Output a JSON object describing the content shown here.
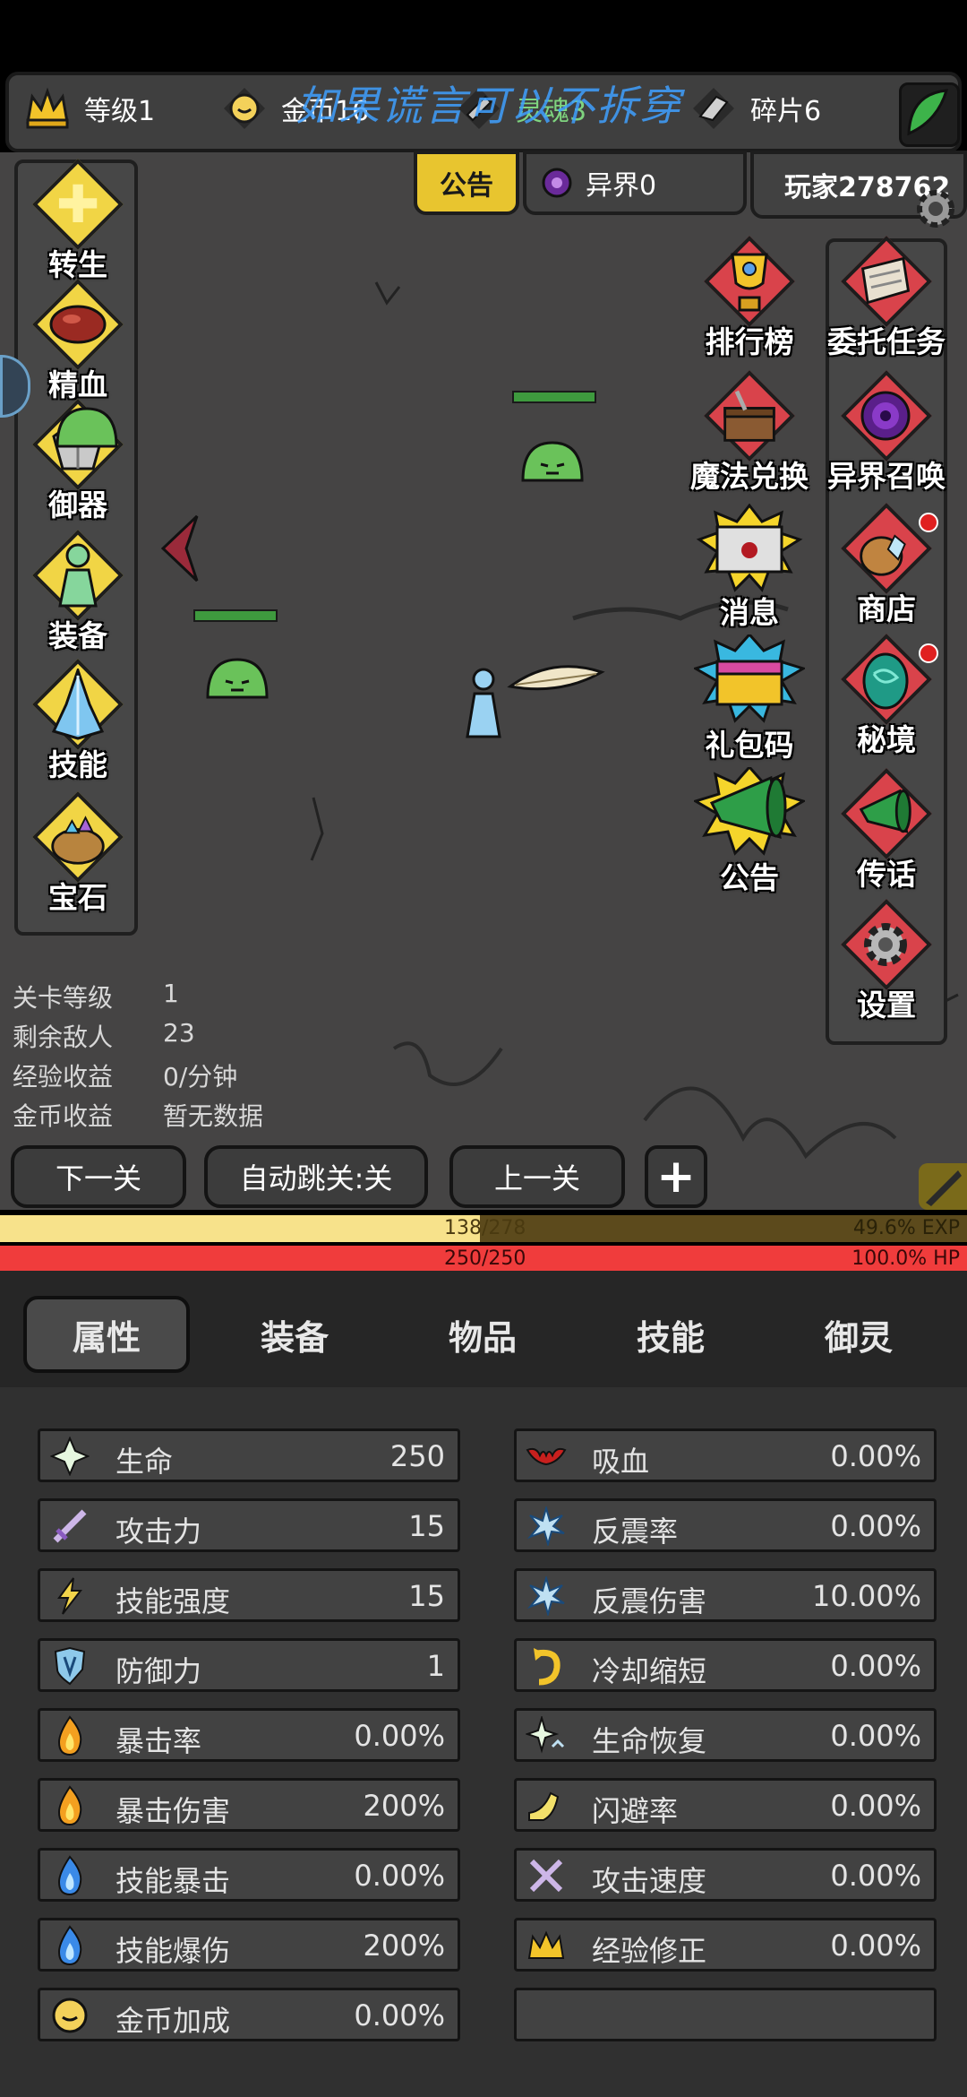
{
  "top_bar": {
    "level": "等级1",
    "gold": "金币16",
    "soul": "灵魂3",
    "fragments": "碎片6",
    "watermark": "如果谎言可以不拆穿"
  },
  "header_tabs": {
    "announcement": "公告",
    "otherworld": "异界0",
    "player": "玩家278762"
  },
  "left_menu": [
    "转生",
    "精血",
    "御器",
    "装备",
    "技能",
    "宝石"
  ],
  "right_menu_col1": [
    "排行榜",
    "魔法兑换",
    "消息",
    "礼包码",
    "公告"
  ],
  "right_menu_col2": [
    "委托任务",
    "异界召唤",
    "商店",
    "秘境",
    "传话",
    "设置"
  ],
  "level_stats": [
    {
      "label": "关卡等级",
      "value": "1"
    },
    {
      "label": "剩余敌人",
      "value": "23"
    },
    {
      "label": "经验收益",
      "value": "0/分钟"
    },
    {
      "label": "金币收益",
      "value": "暂无数据"
    }
  ],
  "nav_buttons": {
    "next": "下一关",
    "auto": "自动跳关:关",
    "prev": "上一关",
    "plus": "+"
  },
  "exp_bar": {
    "text": "138/278",
    "percent_text": "49.6% EXP",
    "fraction": 0.496
  },
  "hp_bar": {
    "text": "250/250",
    "percent_text": "100.0% HP",
    "fraction": 1.0
  },
  "tabs": [
    "属性",
    "装备",
    "物品",
    "技能",
    "御灵"
  ],
  "attributes_left": [
    {
      "icon": "cross-icon",
      "name": "生命",
      "value": "250"
    },
    {
      "icon": "sword-icon",
      "name": "攻击力",
      "value": "15"
    },
    {
      "icon": "lightning-icon",
      "name": "技能强度",
      "value": "15"
    },
    {
      "icon": "shield-icon",
      "name": "防御力",
      "value": "1"
    },
    {
      "icon": "fire-icon",
      "name": "暴击率",
      "value": "0.00%"
    },
    {
      "icon": "fire-icon",
      "name": "暴击伤害",
      "value": "200%"
    },
    {
      "icon": "blue-fire-icon",
      "name": "技能暴击",
      "value": "0.00%"
    },
    {
      "icon": "blue-fire-icon",
      "name": "技能爆伤",
      "value": "200%"
    },
    {
      "icon": "coin-icon",
      "name": "金币加成",
      "value": "0.00%"
    }
  ],
  "attributes_right": [
    {
      "icon": "bat-icon",
      "name": "吸血",
      "value": "0.00%"
    },
    {
      "icon": "spark-icon",
      "name": "反震率",
      "value": "0.00%"
    },
    {
      "icon": "spark-icon",
      "name": "反震伤害",
      "value": "10.00%"
    },
    {
      "icon": "cooldown-icon",
      "name": "冷却缩短",
      "value": "0.00%"
    },
    {
      "icon": "regen-icon",
      "name": "生命恢复",
      "value": "0.00%"
    },
    {
      "icon": "boot-icon",
      "name": "闪避率",
      "value": "0.00%"
    },
    {
      "icon": "swords-icon",
      "name": "攻击速度",
      "value": "0.00%"
    },
    {
      "icon": "crown-icon",
      "name": "经验修正",
      "value": "0.00%"
    }
  ]
}
